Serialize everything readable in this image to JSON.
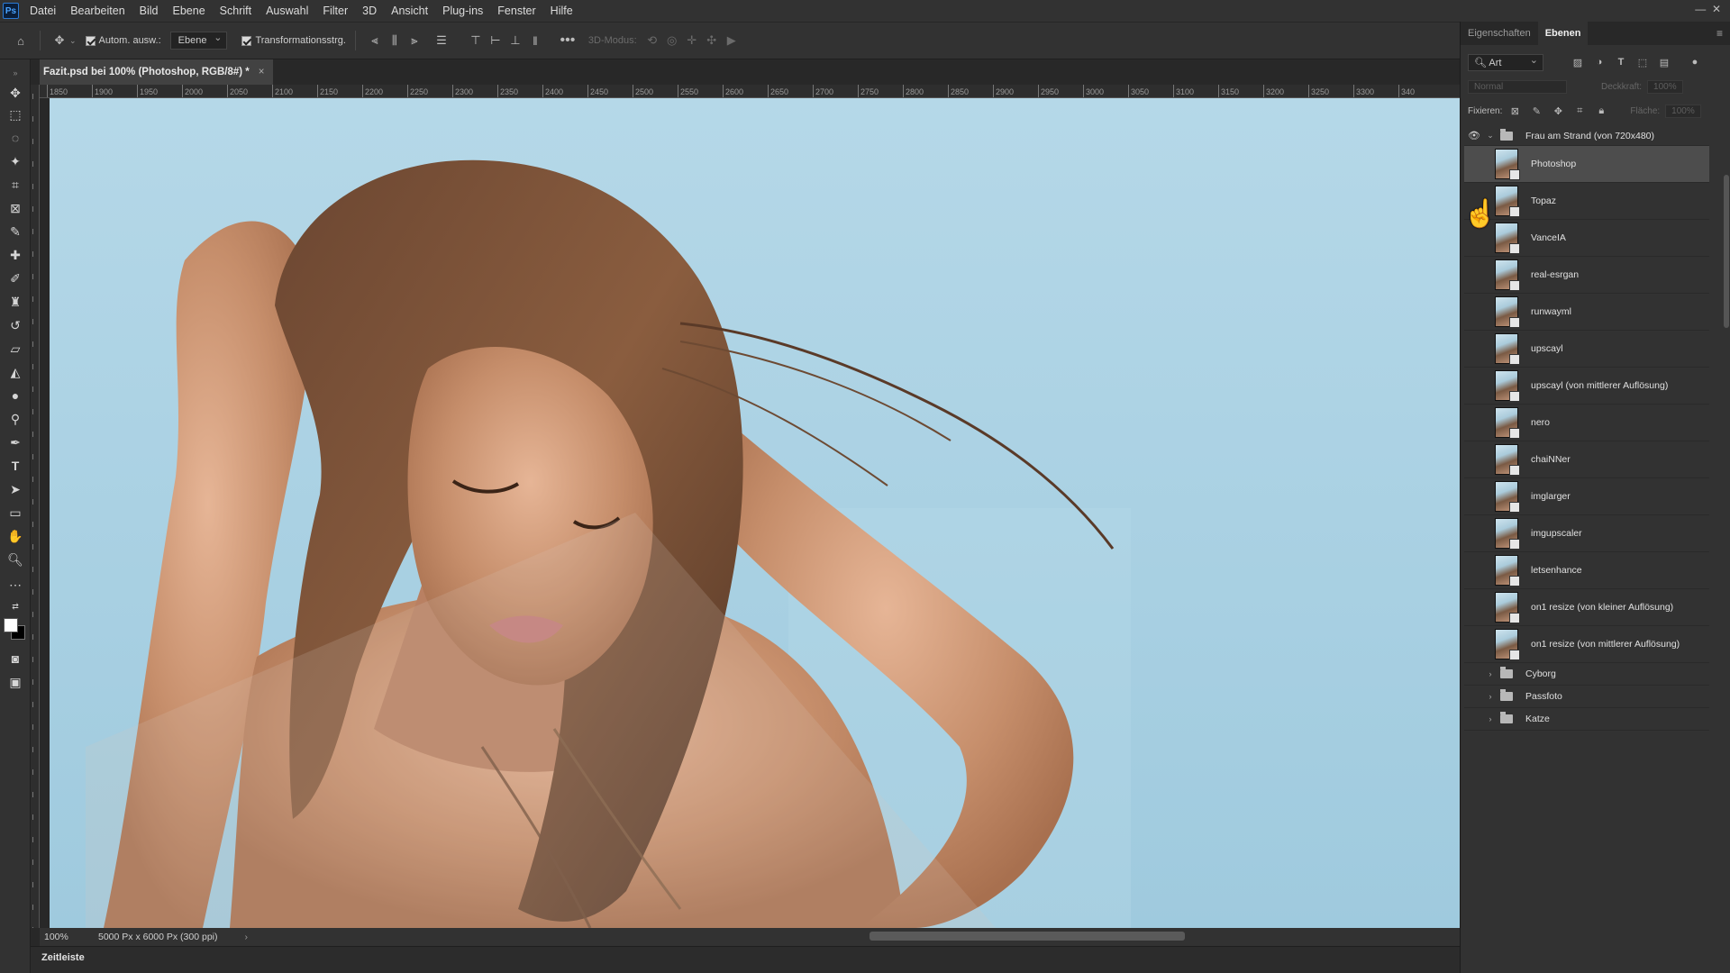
{
  "menubar": {
    "logo": "Ps",
    "items": [
      "Datei",
      "Bearbeiten",
      "Bild",
      "Ebene",
      "Schrift",
      "Auswahl",
      "Filter",
      "3D",
      "Ansicht",
      "Plug-ins",
      "Fenster",
      "Hilfe"
    ]
  },
  "options": {
    "auto_select_label": "Autom. ausw.:",
    "auto_select_target": "Ebene",
    "transform_label": "Transformationsstrg.",
    "mode_3d": "3D-Modus:"
  },
  "document": {
    "tab_title": "Fazit.psd bei 100% (Photoshop, RGB/8#) *",
    "close": "×"
  },
  "ruler": {
    "top_ticks": [
      "1850",
      "1900",
      "1950",
      "2000",
      "2050",
      "2100",
      "2150",
      "2200",
      "2250",
      "2300",
      "2350",
      "2400",
      "2450",
      "2500",
      "2550",
      "2600",
      "2650",
      "2700",
      "2750",
      "2800",
      "2850",
      "2900",
      "2950",
      "3000",
      "3050",
      "3100",
      "3150",
      "3200",
      "3250",
      "3300",
      "340"
    ]
  },
  "status": {
    "zoom": "100%",
    "info": "5000 Px x 6000 Px (300 ppi)",
    "arrow": "›"
  },
  "timeline": {
    "label": "Zeitleiste"
  },
  "panel": {
    "tabs": [
      "Eigenschaften",
      "Ebenen"
    ],
    "active_tab": "Ebenen",
    "filter_kind": "Art",
    "blend_mode": "Normal",
    "opacity_label": "Deckkraft:",
    "opacity_value": "100%",
    "lock_label": "Fixieren:",
    "fill_label": "Fläche:",
    "fill_value": "100%",
    "group_open": {
      "name": "Frau am Strand (von 720x480)"
    },
    "layers": [
      {
        "name": "Photoshop",
        "selected": true
      },
      {
        "name": "Topaz"
      },
      {
        "name": "VanceIA"
      },
      {
        "name": "real-esrgan"
      },
      {
        "name": "runwayml"
      },
      {
        "name": "upscayl"
      },
      {
        "name": "upscayl (von mittlerer Auflösung)"
      },
      {
        "name": "nero"
      },
      {
        "name": "chaiNNer"
      },
      {
        "name": "imglarger"
      },
      {
        "name": "imgupscaler"
      },
      {
        "name": "letsenhance"
      },
      {
        "name": "on1 resize (von kleiner Auflösung)"
      },
      {
        "name": "on1 resize (von mittlerer Auflösung)"
      }
    ],
    "groups_closed": [
      {
        "name": "Cyborg"
      },
      {
        "name": "Passfoto"
      },
      {
        "name": "Katze"
      }
    ]
  },
  "colors": {
    "chrome": "#323232",
    "canvas_sky": "#a7cfe1",
    "selected_layer": "#4d4d4d"
  }
}
